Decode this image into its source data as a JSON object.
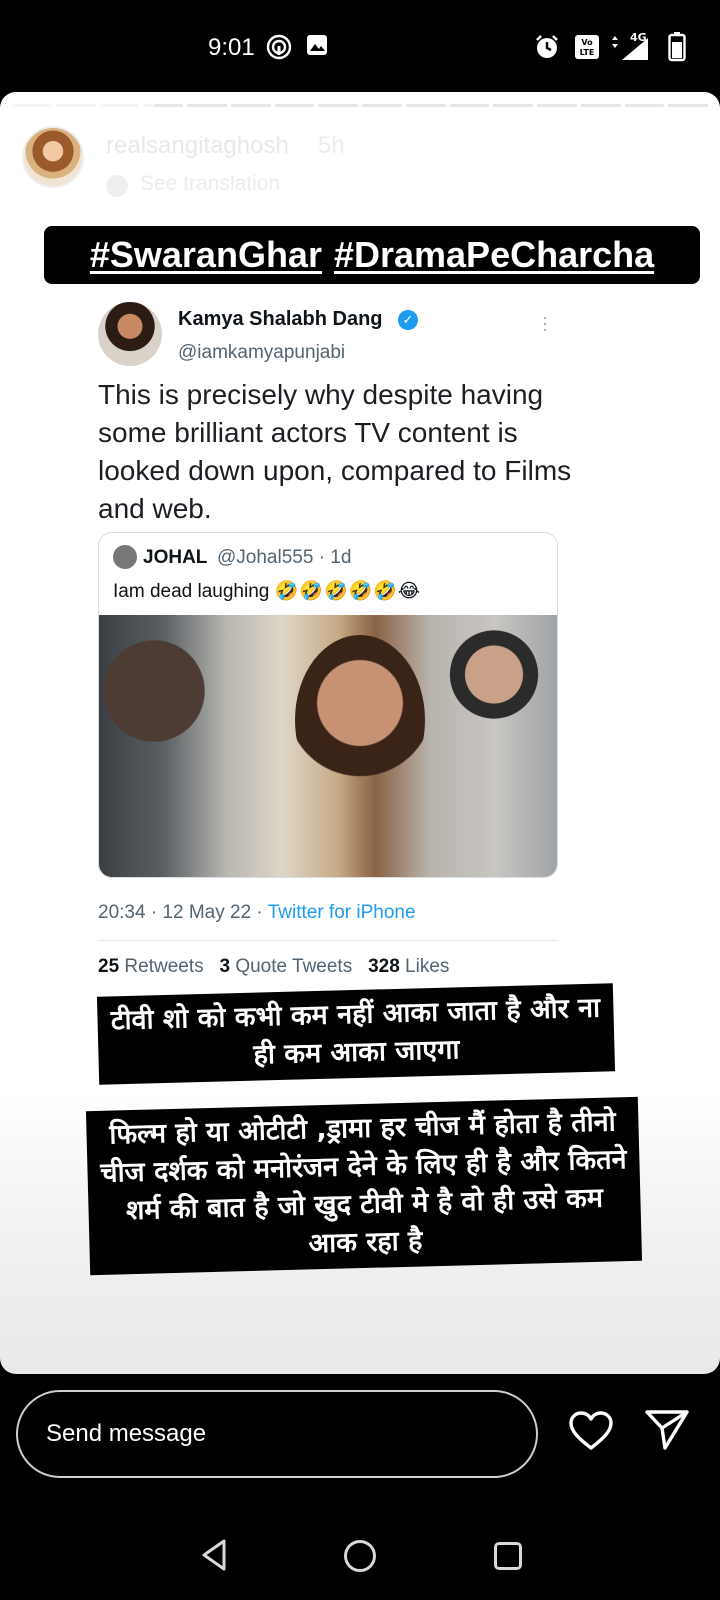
{
  "status_bar": {
    "time": "9:01",
    "network": "4G",
    "volte": "Vo LTE",
    "icons": [
      "hotspot-icon",
      "image-icon",
      "alarm-icon",
      "volte-icon",
      "signal-icon",
      "battery-icon"
    ]
  },
  "story": {
    "progress_segments_total": 16,
    "progress_segments_viewed": 3,
    "username": "realsangitaghosh",
    "time_ago": "5h",
    "translate_label": "See translation",
    "hashtags": [
      "#SwaranGhar",
      "#DramaPeCharcha"
    ]
  },
  "tweet": {
    "author_name": "Kamya Shalabh Dang",
    "author_handle": "@iamkamyapunjabi",
    "text": "This is precisely why despite having some brilliant actors TV content is looked down upon, compared to Films and web.",
    "quote": {
      "name": "JOHAL",
      "handle": "@Johal555 · 1d",
      "text": "Iam dead laughing",
      "emojis": "🤣🤣🤣🤣🤣😂"
    },
    "timestamp": "20:34 · 12 May 22 · ",
    "source": "Twitter for iPhone",
    "stats": {
      "retweets_count": "25",
      "retweets_label": "Retweets",
      "quotes_count": "3",
      "quotes_label": "Quote Tweets",
      "likes_count": "328",
      "likes_label": "Likes"
    }
  },
  "captions": {
    "first": "टीवी शो को कभी कम नहीं आका जाता है और ना ही कम आका जाएगा",
    "second": "फिल्म हो या ओटीटी ,ड्रामा हर चीज मैं होता है तीनो चीज दर्शक को मनोरंजन देने के लिए ही है और कितने शर्म की बात है जो खुद टीवी मे  है वो ही उसे कम आक रहा है"
  },
  "reply_bar": {
    "placeholder": "Send message"
  },
  "colors": {
    "twitter_blue": "#1d9bf0",
    "background": "#000000",
    "story_bg": "#ffffff"
  }
}
